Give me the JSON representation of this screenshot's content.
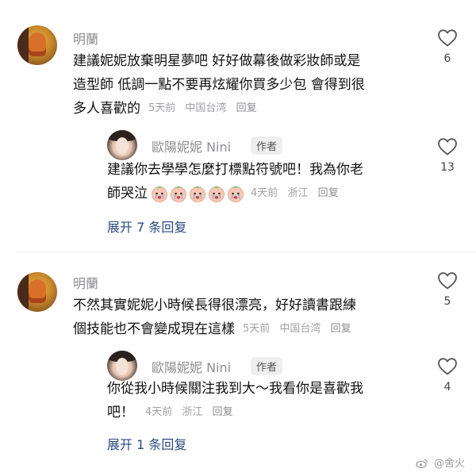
{
  "thread1": {
    "comment": {
      "name": "明蘭",
      "lines": [
        "建議妮妮放棄明星夢吧 好好做幕後做彩妝師或是",
        "造型師 低調一點不要再炫耀你買多少包 會得到很",
        "多人喜歡的"
      ],
      "time": "5天前",
      "location": "中国台湾",
      "reply": "回复",
      "likes": "6"
    },
    "reply": {
      "name": "歐陽妮妮 Nini",
      "badge": "作者",
      "lines": [
        "建議你去學學怎麼打標點符號吧！我為你老",
        "師哭泣"
      ],
      "emoji_count": 5,
      "time": "4天前",
      "location": "浙江",
      "reply": "回复",
      "likes": "13"
    },
    "expand": "展开 7 条回复"
  },
  "thread2": {
    "comment": {
      "name": "明蘭",
      "lines": [
        "不然其實妮妮小時候長得很漂亮，好好讀書跟練",
        "個技能也不會變成現在這樣"
      ],
      "time": "5天前",
      "location": "中国台湾",
      "reply": "回复",
      "likes": "5"
    },
    "reply": {
      "name": "歐陽妮妮 Nini",
      "badge": "作者",
      "lines": [
        "你從我小時候關注我到大～我看你是喜歡我",
        "吧！"
      ],
      "time": "4天前",
      "location": "浙江",
      "reply": "回复",
      "likes": "4"
    },
    "expand": "展开 1 条回复"
  },
  "watermark": "@舍火",
  "icons": {
    "like": "heart-outline-icon",
    "emoji": "crying-face-emoji-icon",
    "watermark_logo": "weibo-logo-icon"
  },
  "colors": {
    "name": "#8e8e93",
    "link": "#2b4a7e",
    "meta": "#a0a0a5"
  }
}
